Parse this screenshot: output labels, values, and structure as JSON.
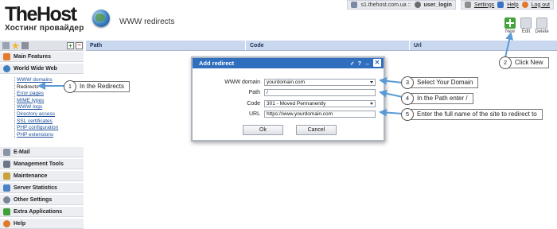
{
  "header": {
    "logo_main": "TheHost",
    "logo_sub": "Хостинг провайдер",
    "page_title": "WWW redirects"
  },
  "topbar": {
    "server": "s1.thehost.com.ua ::",
    "user": "user_login",
    "settings": "Settings",
    "help": "Help",
    "logout": "Log out"
  },
  "toolbar": {
    "new_label": "New",
    "edit_label": "Edit",
    "delete_label": "Delete"
  },
  "sidebar": {
    "sections_top": [
      {
        "label": "Main Features",
        "icon": "main-features-icon"
      },
      {
        "label": "World Wide Web",
        "icon": "world-wide-web-icon"
      }
    ],
    "subitems": [
      "WWW domains",
      "Redirects",
      "Error pages",
      "MIME types",
      "WWW logs",
      "Directory access",
      "SSL certificates",
      "PHP configuration",
      "PHP extensions"
    ],
    "sections_bottom": [
      {
        "label": "E-Mail",
        "icon": "email-icon"
      },
      {
        "label": "Management Tools",
        "icon": "tools-icon"
      },
      {
        "label": "Maintenance",
        "icon": "maintenance-icon"
      },
      {
        "label": "Server Statistics",
        "icon": "statistics-icon"
      },
      {
        "label": "Other Settings",
        "icon": "settings-icon"
      },
      {
        "label": "Extra Applications",
        "icon": "extra-apps-icon"
      },
      {
        "label": "Help",
        "icon": "help-icon"
      }
    ]
  },
  "table": {
    "columns": [
      "Path",
      "Code",
      "Url"
    ]
  },
  "dialog": {
    "title": "Add redirect",
    "fields": {
      "www_domain": {
        "label": "WWW domain",
        "value": "yourdomain.com"
      },
      "path": {
        "label": "Path",
        "value": "/"
      },
      "code": {
        "label": "Code",
        "value": "301 - Moved Permanently"
      },
      "url": {
        "label": "URL",
        "value": "https://www.yourdomain.com"
      }
    },
    "ok": "Ok",
    "cancel": "Cancel",
    "help_glyph": "?"
  },
  "callouts": [
    {
      "num": "1",
      "text": "In the Redirects"
    },
    {
      "num": "2",
      "text": "Click New"
    },
    {
      "num": "3",
      "text": "Select Your Domain"
    },
    {
      "num": "4",
      "text": "In the Path enter /"
    },
    {
      "num": "5",
      "text": "Enter the full name of the site to redirect to"
    }
  ],
  "colors": {
    "accent": "#2f6fbe",
    "callout_arrow": "#5b9bd5",
    "table_header": "#c9d8ef"
  }
}
